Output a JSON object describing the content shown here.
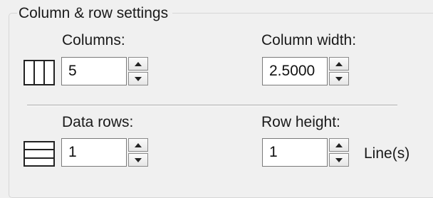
{
  "group": {
    "title": "Column & row settings"
  },
  "columns": {
    "label": "Columns:",
    "value": "5",
    "icon": "columns-icon"
  },
  "column_width": {
    "label": "Column width:",
    "value": "2.5000"
  },
  "data_rows": {
    "label": "Data rows:",
    "value": "1",
    "icon": "rows-icon"
  },
  "row_height": {
    "label": "Row height:",
    "value": "1",
    "unit": "Line(s)"
  }
}
